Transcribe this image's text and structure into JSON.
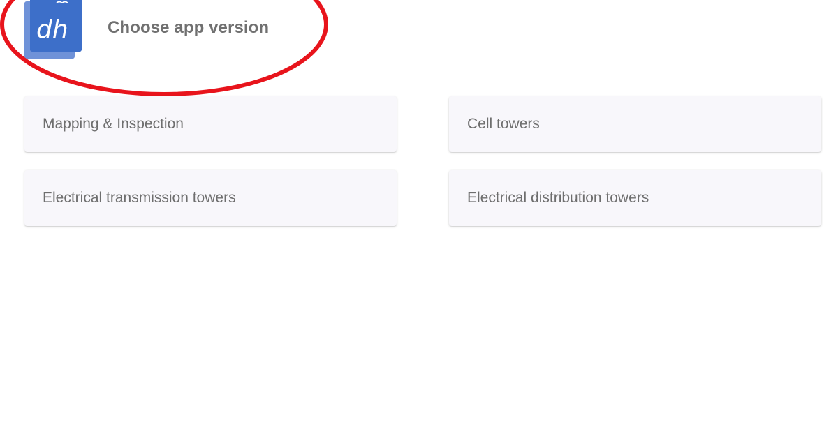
{
  "header": {
    "logo_text": "dh",
    "title": "Choose app version"
  },
  "versions": [
    {
      "label": "Mapping & Inspection"
    },
    {
      "label": "Cell towers"
    },
    {
      "label": "Electrical transmission towers"
    },
    {
      "label": "Electrical distribution towers"
    }
  ],
  "colors": {
    "logo_blue": "#3d6fc9",
    "logo_back": "#6f92d8",
    "annotation_red": "#e8141c",
    "card_bg": "#f8f7fb",
    "text_gray": "#6e6e6e"
  }
}
